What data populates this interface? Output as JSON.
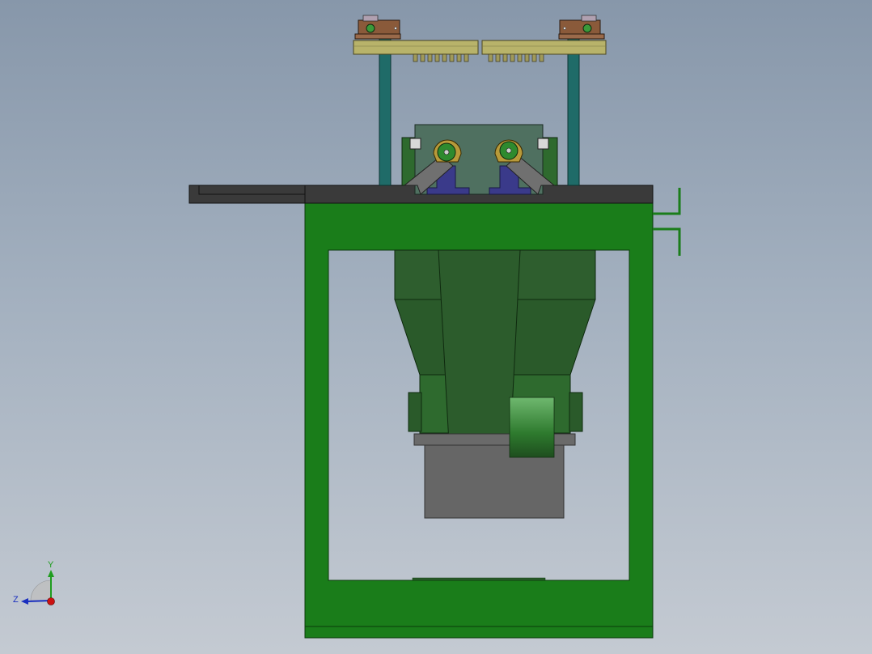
{
  "viewport": {
    "background_top": "#8797aa",
    "background_bottom": "#c4cad2"
  },
  "triad": {
    "y_label": "Y",
    "z_label": "Z",
    "y_color": "#1f9d1f",
    "z_color": "#1a2fbf",
    "x_color": "#cc1111"
  },
  "colors": {
    "frame": "#1a7a1a",
    "table": "#3a3a3a",
    "hopper": "#2e5e2e",
    "motor": "#666666",
    "posts": "#1f6b68",
    "rail": "#b8b36a",
    "clamp": "#8a5a3a",
    "housing": "#4f7060",
    "base_blue": "#3a3a8a"
  }
}
